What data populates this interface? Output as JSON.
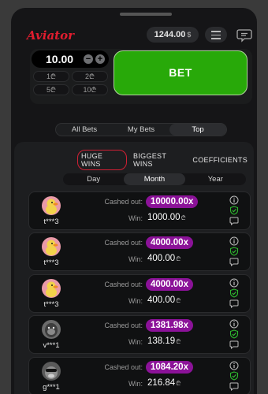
{
  "header": {
    "logo": "Aviator",
    "balance": "1244.00",
    "currency": "$"
  },
  "bet_panel": {
    "amount": "10.00",
    "minus": "−",
    "plus": "+",
    "quick_amounts": [
      "1",
      "2",
      "5",
      "10"
    ],
    "quick_currency": "₾",
    "bet_label": "BET"
  },
  "main_tabs": [
    "All Bets",
    "My Bets",
    "Top"
  ],
  "active_main_tab": "Top",
  "filters": [
    "HUGE WINS",
    "BIGGEST WINS",
    "COEFFICIENTS"
  ],
  "active_filter": "HUGE WINS",
  "periods": [
    "Day",
    "Month",
    "Year"
  ],
  "active_period": "Month",
  "labels": {
    "cashed_out": "Cashed out:",
    "win": "Win:"
  },
  "win_currency": "₾",
  "rows": [
    {
      "user": "t***3",
      "cashed_out": "10000.00x",
      "win": "1000.00",
      "avatar": "duck"
    },
    {
      "user": "t***3",
      "cashed_out": "4000.00x",
      "win": "400.00",
      "avatar": "duck"
    },
    {
      "user": "t***3",
      "cashed_out": "4000.00x",
      "win": "400.00",
      "avatar": "duck"
    },
    {
      "user": "v***1",
      "cashed_out": "1381.98x",
      "win": "138.19",
      "avatar": "gorilla"
    },
    {
      "user": "g***1",
      "cashed_out": "1084.20x",
      "win": "216.84",
      "avatar": "dog"
    }
  ],
  "colors": {
    "accent_red": "#e11d2f",
    "bet_green": "#28a909",
    "multiplier_purple": "#8b1298",
    "verified_green": "#2eb82e"
  },
  "icons": [
    "menu-icon",
    "chat-icon",
    "info-icon",
    "shield-check-icon",
    "comment-icon"
  ]
}
